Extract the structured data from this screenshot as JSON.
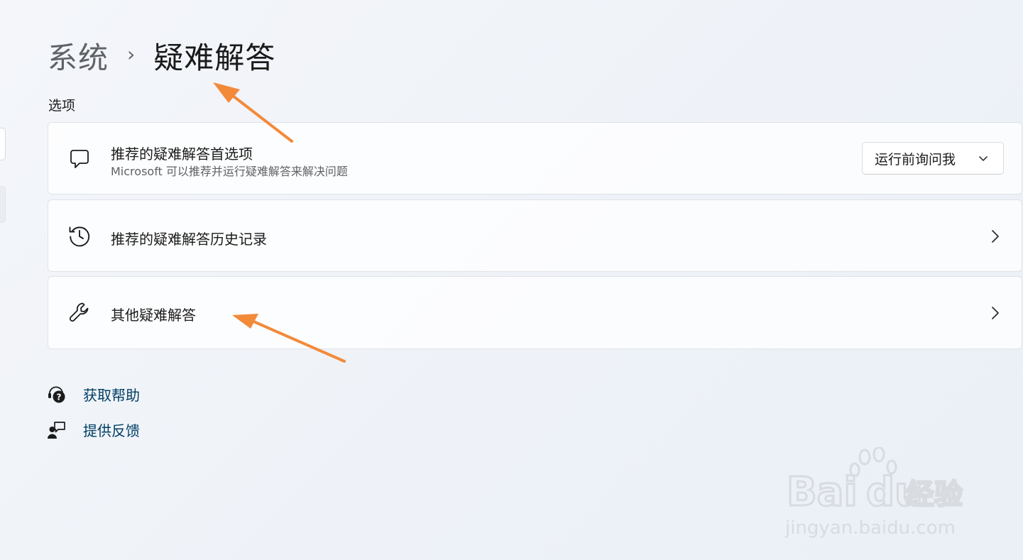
{
  "breadcrumb": {
    "parent": "系统",
    "separator": "›",
    "current": "疑难解答"
  },
  "section": {
    "label": "选项"
  },
  "cards": [
    {
      "title": "推荐的疑难解答首选项",
      "subtitle": "Microsoft 可以推荐并运行疑难解答来解决问题",
      "icon": "chat-bubble-icon",
      "dropdown": {
        "selected": "运行前询问我"
      }
    },
    {
      "title": "推荐的疑难解答历史记录",
      "icon": "history-icon"
    },
    {
      "title": "其他疑难解答",
      "icon": "wrench-icon"
    }
  ],
  "links": [
    {
      "label": "获取帮助",
      "icon": "help-icon"
    },
    {
      "label": "提供反馈",
      "icon": "feedback-icon"
    }
  ],
  "annotations": {
    "arrow_color": "#f28a3a"
  },
  "watermark": {
    "brand": "Bai du 经验",
    "url": "jingyan.baidu.com"
  },
  "colors": {
    "link": "#003e63",
    "card_background": "#ffffff",
    "page_background": "#f2f5f9"
  }
}
